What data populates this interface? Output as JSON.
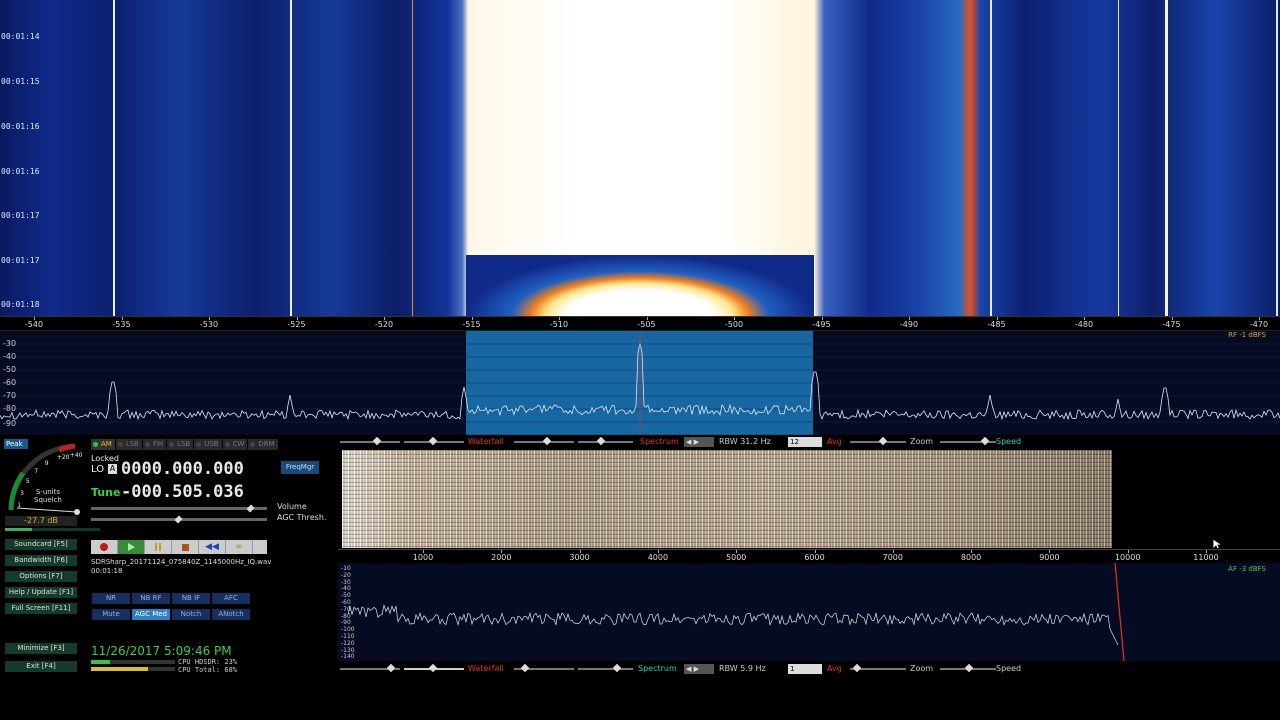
{
  "rf_waterfall": {
    "timestamps": [
      "00:01:14",
      "00:01:15",
      "00:01:16",
      "00:01:16",
      "00:01:17",
      "00:01:17",
      "00:01:18"
    ]
  },
  "rf_axis": {
    "ticks": [
      "-540",
      "-535",
      "-530",
      "-525",
      "-520",
      "-515",
      "-510",
      "-505",
      "-500",
      "-495",
      "-490",
      "-485",
      "-480",
      "-475",
      "-470"
    ]
  },
  "rf_spectrum": {
    "db_ticks": [
      "-30",
      "-40",
      "-50",
      "-60",
      "-70",
      "-80",
      "-90"
    ],
    "corner_label": "RF -1 dBFS",
    "passband_color": "#1a78b8"
  },
  "left_panel": {
    "peak_label": "Peak",
    "smeter": {
      "scale": [
        "1",
        "3",
        "5",
        "7",
        "9",
        "+20",
        "+40"
      ],
      "label_line1": "S-units",
      "label_line2": "Squelch"
    },
    "db_readout": "-27.7 dB",
    "modes": [
      {
        "label": "AM",
        "active": true
      },
      {
        "label": "LSB",
        "active": false
      },
      {
        "label": "FM",
        "active": false
      },
      {
        "label": "LSB",
        "active": false
      },
      {
        "label": "USB",
        "active": false
      },
      {
        "label": "CW",
        "active": false
      },
      {
        "label": "DRM",
        "active": false
      }
    ],
    "locked_label": "Locked",
    "lo_label": "LO",
    "lo_vfo": "A",
    "lo_frequency": "0000.000.000",
    "tune_label": "Tune",
    "tune_frequency": "-000.505.036",
    "freqmgr_label": "FreqMgr",
    "volume_label": "Volume",
    "agc_thresh_label": "AGC Thresh.",
    "side_buttons": {
      "soundcard": "Soundcard  [F5]",
      "bandwidth": "Bandwidth  [F6]",
      "options": "Options  [F7]",
      "help": "Help / Update  [F1]",
      "fullscreen": "Full Screen  [F11]",
      "minimize": "Minimize  [F3]",
      "exit": "Exit  [F4]"
    },
    "file_name": "SDRSharp_20171124_075840Z_1145000Hz_IQ.wav",
    "file_time": "00:01:18",
    "dsp": {
      "nr": "NR",
      "nb_rf": "NB RF",
      "nb_if": "NB IF",
      "afc": "AFC",
      "mute": "Mute",
      "agc_med": "AGC Med",
      "notch": "Notch",
      "anotch": "ANotch"
    },
    "datetime": "11/26/2017 5:09:46 PM",
    "cpu_hdsdr_label": "CPU HDSDR: 23%",
    "cpu_total_label": "CPU Total: 68%",
    "cpu_hdsdr_pct": 23,
    "cpu_total_pct": 68
  },
  "af_toolbar_top": {
    "waterfall_label": "Waterfall",
    "spectrum_label": "Spectrum",
    "rbw_label": "RBW 31.2 Hz",
    "avg_value": "12",
    "avg_label": "Avg",
    "zoom_label": "Zoom",
    "speed_label": "Speed"
  },
  "af_axis": {
    "ticks": [
      "1000",
      "2000",
      "3000",
      "4000",
      "5000",
      "6000",
      "7000",
      "8000",
      "9000",
      "10000",
      "11000"
    ]
  },
  "af_spectrum": {
    "db_ticks": [
      "-10",
      "-20",
      "-30",
      "-40",
      "-50",
      "-60",
      "-70",
      "-80",
      "-90",
      "-100",
      "-110",
      "-120",
      "-130",
      "-140"
    ],
    "corner_label": "AF -3 dBFS"
  },
  "af_toolbar_bottom": {
    "waterfall_label": "Waterfall",
    "spectrum_label": "Spectrum",
    "rbw_label": "RBW 5.9 Hz",
    "avg_value": "1",
    "avg_label": "Avg",
    "zoom_label": "Zoom",
    "speed_label": "Speed"
  },
  "colors": {
    "accent_green": "#3ad040",
    "label_red": "#e83020",
    "label_cyan": "#30d0c0",
    "label_yellow": "#e8c020"
  }
}
